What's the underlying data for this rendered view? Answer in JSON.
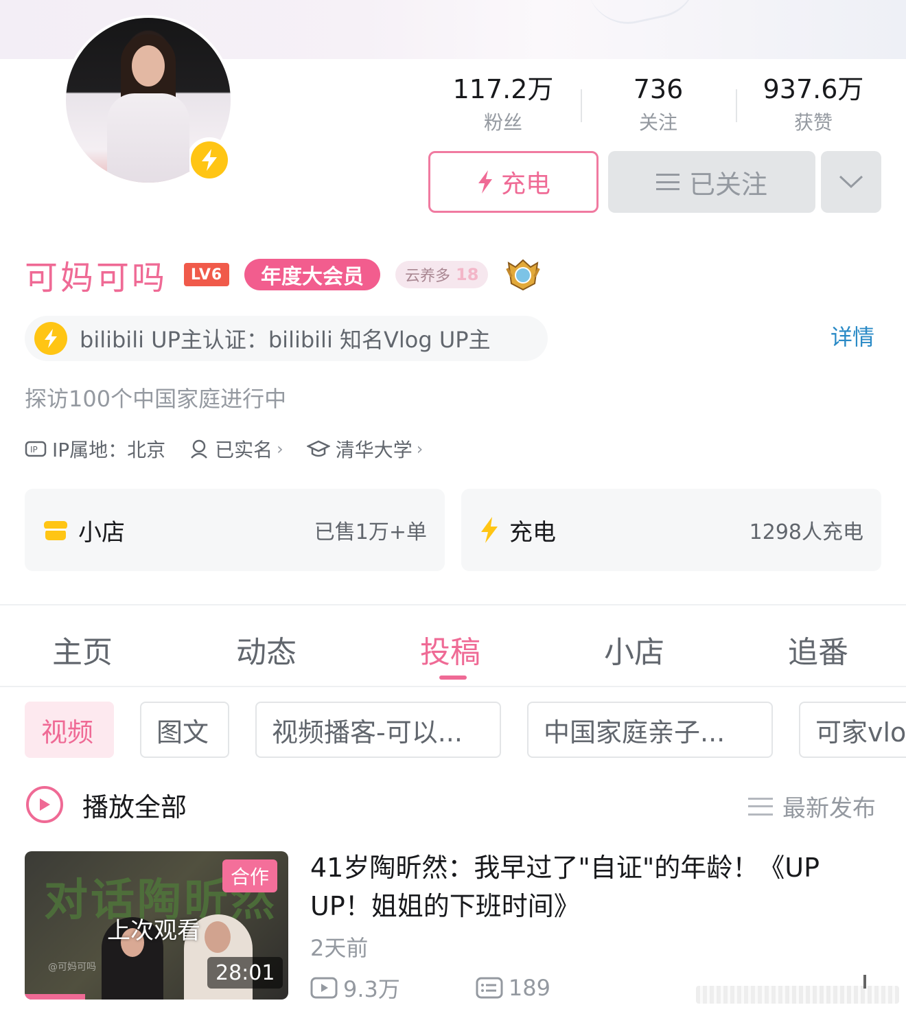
{
  "profile": {
    "name": "可妈可吗",
    "level_badge": "LV6",
    "vip_label": "年度大会员",
    "fan_medal_name": "云养多",
    "fan_medal_level": "18",
    "certification": "bilibili UP主认证：bilibili 知名Vlog UP主",
    "detail_link": "详情",
    "bio": "探访100个中国家庭进行中",
    "ip_location": "IP属地：北京",
    "real_name": "已实名",
    "school": "清华大学"
  },
  "stats": [
    {
      "value": "117.2万",
      "label": "粉丝"
    },
    {
      "value": "736",
      "label": "关注"
    },
    {
      "value": "937.6万",
      "label": "获赞"
    }
  ],
  "actions": {
    "charge_label": "充电",
    "followed_label": "已关注"
  },
  "cards": {
    "shop": {
      "title": "小店",
      "sub": "已售1万+单"
    },
    "charge": {
      "title": "充电",
      "sub": "1298人充电"
    }
  },
  "tabs": [
    "主页",
    "动态",
    "投稿",
    "小店",
    "追番"
  ],
  "active_tab": "投稿",
  "filters": [
    "视频",
    "图文",
    "视频播客-可以...",
    "中国家庭亲子...",
    "可家vlo"
  ],
  "play_all_label": "播放全部",
  "sort_label": "最新发布",
  "video": {
    "title": "41岁陶昕然：我早过了\"自证\"的年龄！《UP UP！姐姐的下班时间》",
    "coop_badge": "合作",
    "last_watched": "上次观看",
    "duration": "28:01",
    "thumb_text": "对话陶昕然",
    "thumb_watermark": "@可妈可吗",
    "watch_progress": 0.23,
    "time": "2天前",
    "views": "9.3万",
    "comments": "189"
  },
  "colors": {
    "accent": "#ef6a95",
    "bolt": "#ffc514",
    "link": "#2a8ac6"
  }
}
